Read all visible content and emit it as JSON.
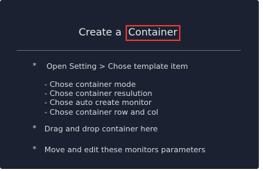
{
  "panel": {
    "title_prefix": "Create a",
    "title_highlight": "Container",
    "bullet_glyph": "*",
    "step_open_setting": "Open Setting > Chose template item",
    "sub_steps": [
      "- Chose container mode",
      "- Chose container resulution",
      "- Chose auto create monitor",
      "- Chose container row and col"
    ],
    "step_drag": "Drag and drop container here",
    "step_move": "Move and edit these monitors parameters"
  },
  "colors": {
    "panel_background": "#1b2130",
    "highlight_border": "#e53935",
    "text": "#d4d8df"
  }
}
